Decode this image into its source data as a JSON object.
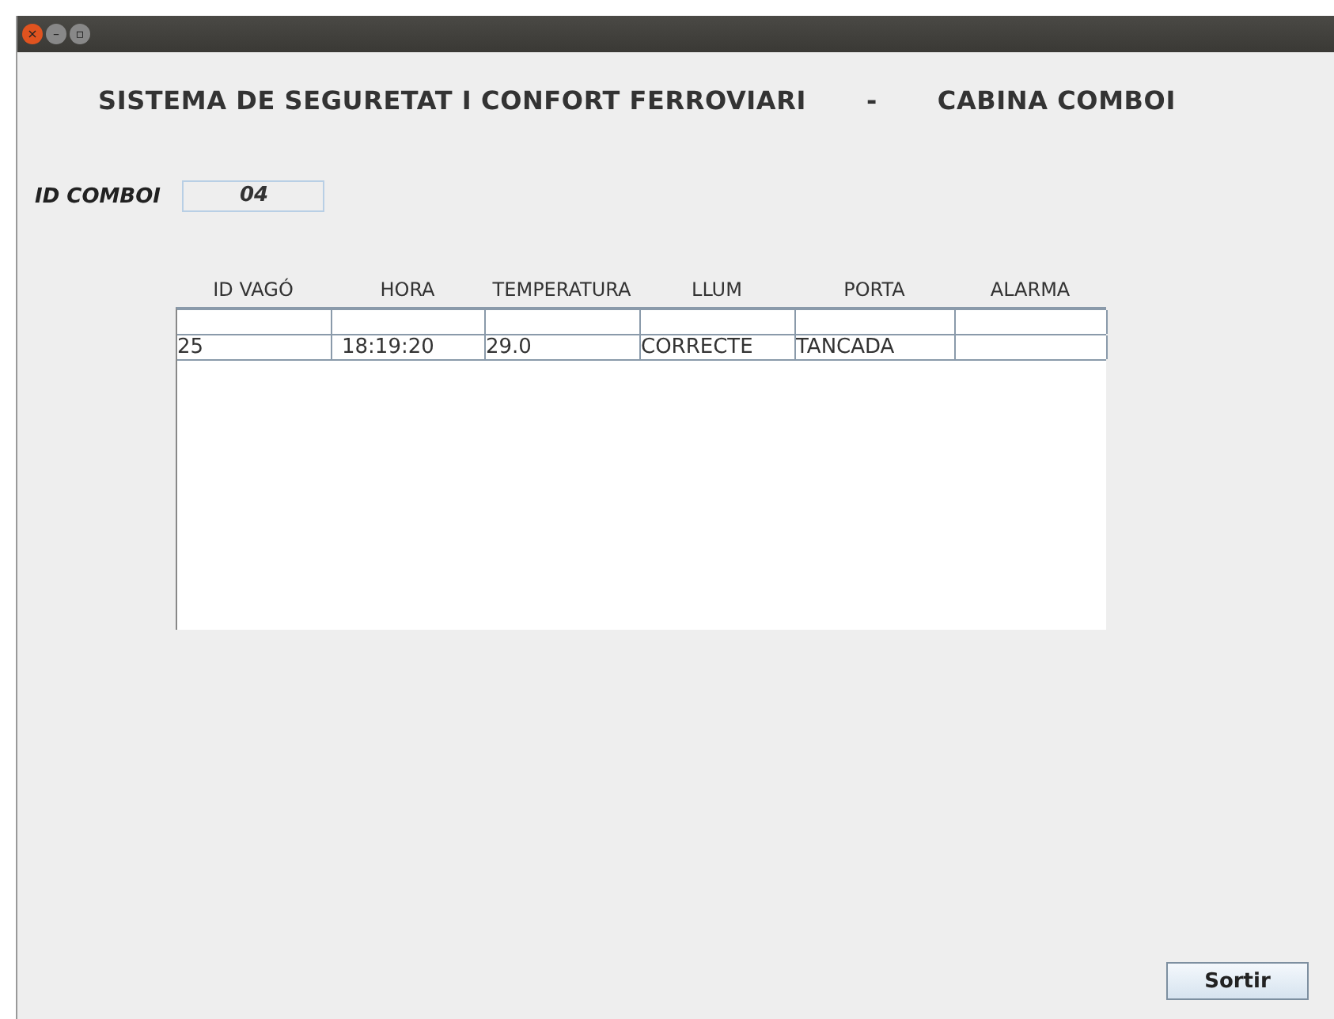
{
  "window": {
    "title_bar": {
      "buttons": [
        "×",
        "–",
        "▫"
      ]
    }
  },
  "heading": {
    "left": "SISTEMA DE SEGURETAT I CONFORT FERROVIARI",
    "separator": "-",
    "right": "CABINA COMBOI"
  },
  "id_field": {
    "label": "ID COMBOI",
    "value": "04"
  },
  "table": {
    "columns": [
      "ID VAGÓ",
      "HORA",
      "TEMPERATURA",
      "LLUM",
      "PORTA",
      "ALARMA"
    ],
    "rows": [
      [
        "",
        "",
        "",
        "",
        "",
        ""
      ],
      [
        "25",
        "18:19:20",
        "29.0",
        "CORRECTE",
        "TANCADA",
        ""
      ]
    ]
  },
  "buttons": [
    "Sortir"
  ]
}
